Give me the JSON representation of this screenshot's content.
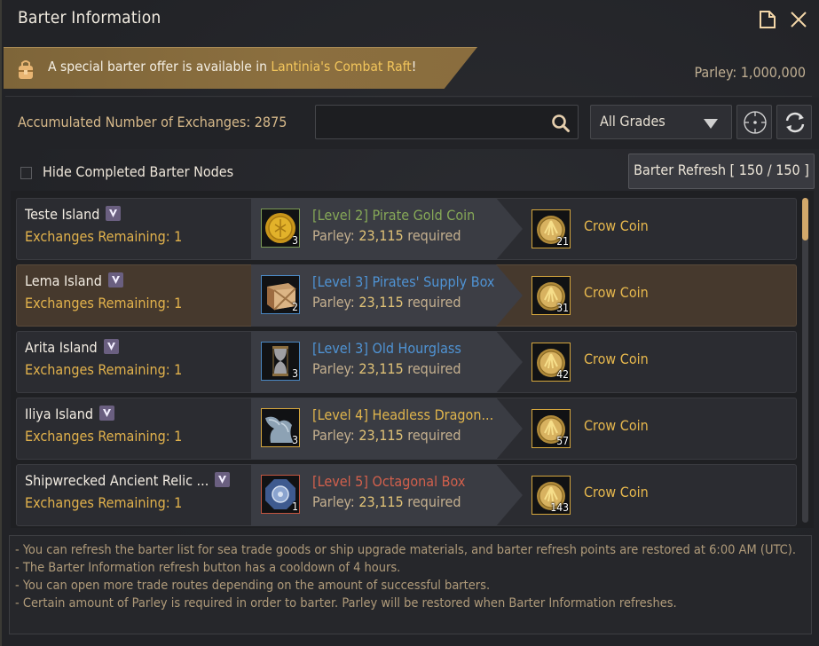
{
  "window": {
    "title": "Barter Information",
    "icons": [
      "document-icon",
      "close-icon"
    ]
  },
  "banner": {
    "icon": "backpack-icon",
    "text_prefix": "A special barter offer is available in ",
    "location": "Lantinia's Combat Raft",
    "text_suffix": "!"
  },
  "parley": {
    "label": "Parley: 1,000,000"
  },
  "toolbar": {
    "accumulated_label": "Accumulated Number of Exchanges: 2875",
    "search_value": "",
    "search_placeholder": "",
    "grade_selected": "All Grades",
    "locate_icon": "crosshair-icon",
    "refresh_icon": "refresh-icon"
  },
  "filters": {
    "hide_completed_label": "Hide Completed Barter Nodes",
    "hide_completed_checked": false,
    "barter_refresh_label": "Barter Refresh [ 150 / 150 ]"
  },
  "rows": [
    {
      "island": "Teste Island",
      "remaining": "Exchanges Remaining: 1",
      "give_item": "[Level 2] Pirate Gold Coin",
      "give_color": "#86a857",
      "give_border": "#7b9a55",
      "give_qty": "3",
      "give_icon": "gold-coin-icon",
      "parley_prefix": "Parley: ",
      "parley_value": "23,115",
      "parley_suffix": " required",
      "reward_name": "Crow Coin",
      "reward_qty": "21",
      "selected": false
    },
    {
      "island": "Lema Island",
      "remaining": "Exchanges Remaining: 1",
      "give_item": "[Level 3] Pirates' Supply Box",
      "give_color": "#4f93d4",
      "give_border": "#4a86c0",
      "give_qty": "2",
      "give_icon": "wooden-crate-icon",
      "parley_prefix": "Parley: ",
      "parley_value": "23,115",
      "parley_suffix": " required",
      "reward_name": "Crow Coin",
      "reward_qty": "31",
      "selected": true
    },
    {
      "island": "Arita Island",
      "remaining": "Exchanges Remaining: 1",
      "give_item": "[Level 3] Old Hourglass",
      "give_color": "#4f93d4",
      "give_border": "#4a86c0",
      "give_qty": "3",
      "give_icon": "hourglass-icon",
      "parley_prefix": "Parley: ",
      "parley_value": "23,115",
      "parley_suffix": " required",
      "reward_name": "Crow Coin",
      "reward_qty": "42",
      "selected": false
    },
    {
      "island": "Iliya Island",
      "remaining": "Exchanges Remaining: 1",
      "give_item": "[Level 4] Headless Dragon...",
      "give_color": "#e0b54c",
      "give_border": "#d6a73d",
      "give_qty": "3",
      "give_icon": "dragon-statue-icon",
      "parley_prefix": "Parley: ",
      "parley_value": "23,115",
      "parley_suffix": " required",
      "reward_name": "Crow Coin",
      "reward_qty": "57",
      "selected": false
    },
    {
      "island": "Shipwrecked Ancient Relic ...",
      "remaining": "Exchanges Remaining: 1",
      "give_item": "[Level 5] Octagonal Box",
      "give_color": "#d2604c",
      "give_border": "#c2553f",
      "give_qty": "1",
      "give_icon": "octagonal-box-icon",
      "parley_prefix": "Parley: ",
      "parley_value": "23,115",
      "parley_suffix": " required",
      "reward_name": "Crow Coin",
      "reward_qty": "143",
      "selected": false
    }
  ],
  "scroll": {
    "position_fraction": 0.0
  },
  "notes": [
    "- You can refresh the barter list for sea trade goods or ship upgrade materials, and barter refresh points are restored at 6:00 AM (UTC).",
    "- The Barter Information refresh button has a cooldown of 4 hours.",
    "- You can open more trade routes depending on the amount of successful barters.",
    "- Certain amount of Parley is required in order to barter. Parley will be restored when Barter Information refreshes."
  ]
}
